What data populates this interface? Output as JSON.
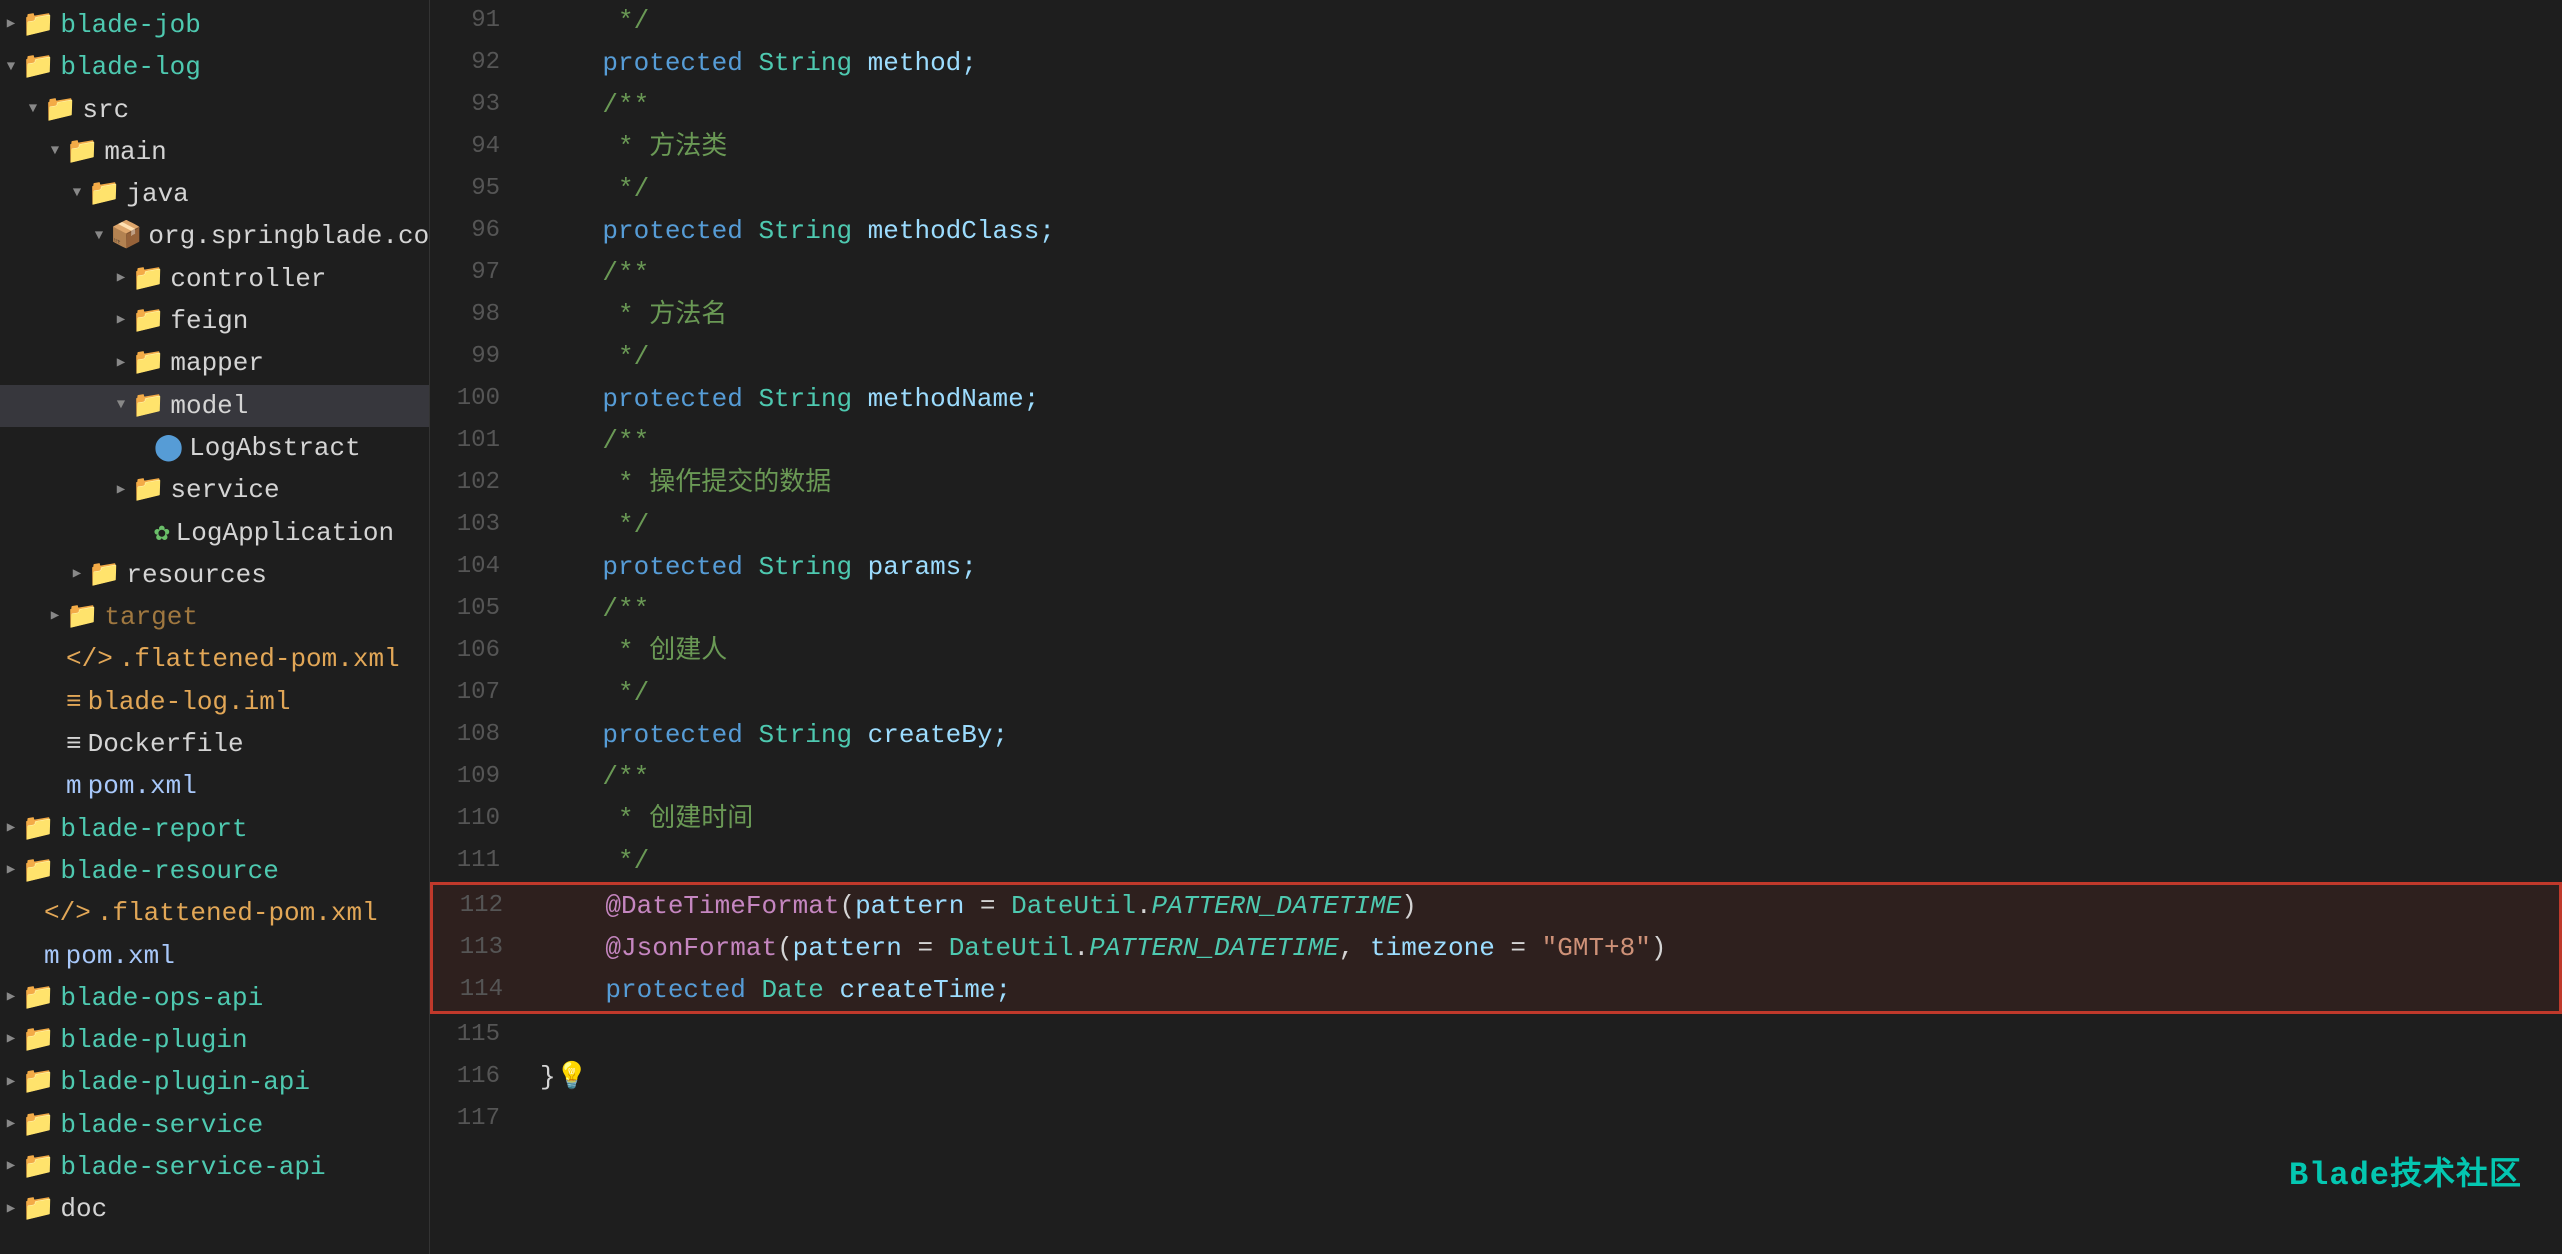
{
  "sidebar": {
    "items": [
      {
        "id": "blade-job",
        "label": "blade-job",
        "indent": 0,
        "arrow": "▶",
        "icon": "folder",
        "iconColor": "#dcb67a",
        "labelColor": "#4ec9b0",
        "selected": false
      },
      {
        "id": "blade-log",
        "label": "blade-log",
        "indent": 0,
        "arrow": "▼",
        "icon": "folder",
        "iconColor": "#dcb67a",
        "labelColor": "#4ec9b0",
        "selected": false
      },
      {
        "id": "src",
        "label": "src",
        "indent": 1,
        "arrow": "▼",
        "icon": "folder",
        "iconColor": "#dcb67a",
        "labelColor": "#d4d4d4",
        "selected": false
      },
      {
        "id": "main",
        "label": "main",
        "indent": 2,
        "arrow": "▼",
        "icon": "folder",
        "iconColor": "#dcb67a",
        "labelColor": "#d4d4d4",
        "selected": false
      },
      {
        "id": "java",
        "label": "java",
        "indent": 3,
        "arrow": "▼",
        "icon": "folder",
        "iconColor": "#569cd6",
        "labelColor": "#d4d4d4",
        "selected": false
      },
      {
        "id": "org.springblade.core.log",
        "label": "org.springblade.core.log",
        "indent": 4,
        "arrow": "▼",
        "icon": "pkg",
        "iconColor": "#dcb67a",
        "labelColor": "#d4d4d4",
        "selected": false
      },
      {
        "id": "controller",
        "label": "controller",
        "indent": 5,
        "arrow": "▶",
        "icon": "folder",
        "iconColor": "#dcb67a",
        "labelColor": "#d4d4d4",
        "selected": false
      },
      {
        "id": "feign",
        "label": "feign",
        "indent": 5,
        "arrow": "▶",
        "icon": "folder",
        "iconColor": "#dcb67a",
        "labelColor": "#d4d4d4",
        "selected": false
      },
      {
        "id": "mapper",
        "label": "mapper",
        "indent": 5,
        "arrow": "▶",
        "icon": "folder",
        "iconColor": "#dcb67a",
        "labelColor": "#d4d4d4",
        "selected": false
      },
      {
        "id": "model",
        "label": "model",
        "indent": 5,
        "arrow": "▼",
        "icon": "folder",
        "iconColor": "#dcb67a",
        "labelColor": "#d4d4d4",
        "selected": true
      },
      {
        "id": "LogAbstract",
        "label": "LogAbstract",
        "indent": 6,
        "arrow": "",
        "icon": "class",
        "iconColor": "#569cd6",
        "labelColor": "#d4d4d4",
        "selected": false
      },
      {
        "id": "service",
        "label": "service",
        "indent": 5,
        "arrow": "▶",
        "icon": "folder",
        "iconColor": "#dcb67a",
        "labelColor": "#d4d4d4",
        "selected": false
      },
      {
        "id": "LogApplication",
        "label": "LogApplication",
        "indent": 6,
        "arrow": "",
        "icon": "spring",
        "iconColor": "#6abf69",
        "labelColor": "#d4d4d4",
        "selected": false
      },
      {
        "id": "resources",
        "label": "resources",
        "indent": 3,
        "arrow": "▶",
        "icon": "folder",
        "iconColor": "#dcb67a",
        "labelColor": "#d4d4d4",
        "selected": false
      },
      {
        "id": "target",
        "label": "target",
        "indent": 2,
        "arrow": "▶",
        "icon": "folder",
        "iconColor": "#a07840",
        "labelColor": "#a07840",
        "selected": false
      },
      {
        "id": ".flattened-pom.xml",
        "label": ".flattened-pom.xml",
        "indent": 2,
        "arrow": "",
        "icon": "xml",
        "iconColor": "#e2a757",
        "labelColor": "#e2a757",
        "selected": false
      },
      {
        "id": "blade-log.iml",
        "label": "blade-log.iml",
        "indent": 2,
        "arrow": "",
        "icon": "iml",
        "iconColor": "#e2a757",
        "labelColor": "#e2a757",
        "selected": false
      },
      {
        "id": "Dockerfile",
        "label": "Dockerfile",
        "indent": 2,
        "arrow": "",
        "icon": "docker",
        "iconColor": "#d4d4d4",
        "labelColor": "#d4d4d4",
        "selected": false
      },
      {
        "id": "pom.xml",
        "label": "pom.xml",
        "indent": 2,
        "arrow": "",
        "icon": "pom",
        "iconColor": "#a8c8fa",
        "labelColor": "#a8c8fa",
        "selected": false
      },
      {
        "id": "blade-report",
        "label": "blade-report",
        "indent": 0,
        "arrow": "▶",
        "icon": "folder",
        "iconColor": "#dcb67a",
        "labelColor": "#4ec9b0",
        "selected": false
      },
      {
        "id": "blade-resource",
        "label": "blade-resource",
        "indent": 0,
        "arrow": "▶",
        "icon": "folder",
        "iconColor": "#dcb67a",
        "labelColor": "#4ec9b0",
        "selected": false
      },
      {
        "id": ".flattened-pom2.xml",
        "label": ".flattened-pom.xml",
        "indent": 1,
        "arrow": "",
        "icon": "xml",
        "iconColor": "#e2a757",
        "labelColor": "#e2a757",
        "selected": false
      },
      {
        "id": "pom2.xml",
        "label": "pom.xml",
        "indent": 1,
        "arrow": "",
        "icon": "pom",
        "iconColor": "#a8c8fa",
        "labelColor": "#a8c8fa",
        "selected": false
      },
      {
        "id": "blade-ops-api",
        "label": "blade-ops-api",
        "indent": 0,
        "arrow": "▶",
        "icon": "folder",
        "iconColor": "#dcb67a",
        "labelColor": "#4ec9b0",
        "selected": false
      },
      {
        "id": "blade-plugin",
        "label": "blade-plugin",
        "indent": 0,
        "arrow": "▶",
        "icon": "folder",
        "iconColor": "#dcb67a",
        "labelColor": "#4ec9b0",
        "selected": false
      },
      {
        "id": "blade-plugin-api",
        "label": "blade-plugin-api",
        "indent": 0,
        "arrow": "▶",
        "icon": "folder",
        "iconColor": "#dcb67a",
        "labelColor": "#4ec9b0",
        "selected": false
      },
      {
        "id": "blade-service",
        "label": "blade-service",
        "indent": 0,
        "arrow": "▶",
        "icon": "folder",
        "iconColor": "#dcb67a",
        "labelColor": "#4ec9b0",
        "selected": false
      },
      {
        "id": "blade-service-api",
        "label": "blade-service-api",
        "indent": 0,
        "arrow": "▶",
        "icon": "folder",
        "iconColor": "#dcb67a",
        "labelColor": "#4ec9b0",
        "selected": false
      },
      {
        "id": "doc",
        "label": "doc",
        "indent": 0,
        "arrow": "▶",
        "icon": "folder",
        "iconColor": "#dcb67a",
        "labelColor": "#d4d4d4",
        "selected": false
      }
    ]
  },
  "code": {
    "lines": [
      {
        "num": 91,
        "tokens": [
          {
            "text": "    ",
            "cls": "plain"
          },
          {
            "text": " */",
            "cls": "comment"
          }
        ],
        "highlight": false
      },
      {
        "num": 92,
        "tokens": [
          {
            "text": "    ",
            "cls": "plain"
          },
          {
            "text": "protected ",
            "cls": "kw"
          },
          {
            "text": "String ",
            "cls": "type"
          },
          {
            "text": "method;",
            "cls": "field"
          }
        ],
        "highlight": false
      },
      {
        "num": 93,
        "tokens": [
          {
            "text": "    ",
            "cls": "plain"
          },
          {
            "text": "/**",
            "cls": "comment"
          }
        ],
        "highlight": false
      },
      {
        "num": 94,
        "tokens": [
          {
            "text": "    ",
            "cls": "plain"
          },
          {
            "text": " * 方法类",
            "cls": "comment"
          }
        ],
        "highlight": false
      },
      {
        "num": 95,
        "tokens": [
          {
            "text": "    ",
            "cls": "plain"
          },
          {
            "text": " */",
            "cls": "comment"
          }
        ],
        "highlight": false
      },
      {
        "num": 96,
        "tokens": [
          {
            "text": "    ",
            "cls": "plain"
          },
          {
            "text": "protected ",
            "cls": "kw"
          },
          {
            "text": "String ",
            "cls": "type"
          },
          {
            "text": "methodClass;",
            "cls": "field"
          }
        ],
        "highlight": false
      },
      {
        "num": 97,
        "tokens": [
          {
            "text": "    ",
            "cls": "plain"
          },
          {
            "text": "/**",
            "cls": "comment"
          }
        ],
        "highlight": false
      },
      {
        "num": 98,
        "tokens": [
          {
            "text": "    ",
            "cls": "plain"
          },
          {
            "text": " * 方法名",
            "cls": "comment"
          }
        ],
        "highlight": false
      },
      {
        "num": 99,
        "tokens": [
          {
            "text": "    ",
            "cls": "plain"
          },
          {
            "text": " */",
            "cls": "comment"
          }
        ],
        "highlight": false
      },
      {
        "num": 100,
        "tokens": [
          {
            "text": "    ",
            "cls": "plain"
          },
          {
            "text": "protected ",
            "cls": "kw"
          },
          {
            "text": "String ",
            "cls": "type"
          },
          {
            "text": "methodName;",
            "cls": "field"
          }
        ],
        "highlight": false
      },
      {
        "num": 101,
        "tokens": [
          {
            "text": "    ",
            "cls": "plain"
          },
          {
            "text": "/**",
            "cls": "comment"
          }
        ],
        "highlight": false
      },
      {
        "num": 102,
        "tokens": [
          {
            "text": "    ",
            "cls": "plain"
          },
          {
            "text": " * 操作提交的数据",
            "cls": "comment"
          }
        ],
        "highlight": false
      },
      {
        "num": 103,
        "tokens": [
          {
            "text": "    ",
            "cls": "plain"
          },
          {
            "text": " */",
            "cls": "comment"
          }
        ],
        "highlight": false
      },
      {
        "num": 104,
        "tokens": [
          {
            "text": "    ",
            "cls": "plain"
          },
          {
            "text": "protected ",
            "cls": "kw"
          },
          {
            "text": "String ",
            "cls": "type"
          },
          {
            "text": "params;",
            "cls": "field"
          }
        ],
        "highlight": false
      },
      {
        "num": 105,
        "tokens": [
          {
            "text": "    ",
            "cls": "plain"
          },
          {
            "text": "/**",
            "cls": "comment"
          }
        ],
        "highlight": false
      },
      {
        "num": 106,
        "tokens": [
          {
            "text": "    ",
            "cls": "plain"
          },
          {
            "text": " * 创建人",
            "cls": "comment"
          }
        ],
        "highlight": false
      },
      {
        "num": 107,
        "tokens": [
          {
            "text": "    ",
            "cls": "plain"
          },
          {
            "text": " */",
            "cls": "comment"
          }
        ],
        "highlight": false
      },
      {
        "num": 108,
        "tokens": [
          {
            "text": "    ",
            "cls": "plain"
          },
          {
            "text": "protected ",
            "cls": "kw"
          },
          {
            "text": "String ",
            "cls": "type"
          },
          {
            "text": "createBy;",
            "cls": "field"
          }
        ],
        "highlight": false
      },
      {
        "num": 109,
        "tokens": [
          {
            "text": "    ",
            "cls": "plain"
          },
          {
            "text": "/**",
            "cls": "comment"
          }
        ],
        "highlight": false
      },
      {
        "num": 110,
        "tokens": [
          {
            "text": "    ",
            "cls": "plain"
          },
          {
            "text": " * 创建时间",
            "cls": "comment"
          }
        ],
        "highlight": false
      },
      {
        "num": 111,
        "tokens": [
          {
            "text": "    ",
            "cls": "plain"
          },
          {
            "text": " */",
            "cls": "comment"
          }
        ],
        "highlight": false
      },
      {
        "num": 112,
        "tokens": [
          {
            "text": "    ",
            "cls": "plain"
          },
          {
            "text": "@DateTimeFormat",
            "cls": "annotation"
          },
          {
            "text": "(",
            "cls": "punct"
          },
          {
            "text": "pattern",
            "cls": "field"
          },
          {
            "text": " = ",
            "cls": "eq"
          },
          {
            "text": "DateUtil",
            "cls": "type"
          },
          {
            "text": ".",
            "cls": "punct"
          },
          {
            "text": "PATTERN_DATETIME",
            "cls": "italic-plain"
          },
          {
            "text": ")",
            "cls": "punct"
          }
        ],
        "highlight": true
      },
      {
        "num": 113,
        "tokens": [
          {
            "text": "    ",
            "cls": "plain"
          },
          {
            "text": "@JsonFormat",
            "cls": "annotation"
          },
          {
            "text": "(",
            "cls": "punct"
          },
          {
            "text": "pattern",
            "cls": "field"
          },
          {
            "text": " = ",
            "cls": "eq"
          },
          {
            "text": "DateUtil",
            "cls": "type"
          },
          {
            "text": ".",
            "cls": "punct"
          },
          {
            "text": "PATTERN_DATETIME",
            "cls": "italic-plain"
          },
          {
            "text": ", ",
            "cls": "punct"
          },
          {
            "text": "timezone",
            "cls": "field"
          },
          {
            "text": " = ",
            "cls": "eq"
          },
          {
            "text": "\"GMT+8\"",
            "cls": "str"
          },
          {
            "text": ")",
            "cls": "punct"
          }
        ],
        "highlight": true
      },
      {
        "num": 114,
        "tokens": [
          {
            "text": "    ",
            "cls": "plain"
          },
          {
            "text": "protected ",
            "cls": "kw"
          },
          {
            "text": "Date ",
            "cls": "type"
          },
          {
            "text": "createTime;",
            "cls": "field"
          }
        ],
        "highlight": true
      },
      {
        "num": 115,
        "tokens": [
          {
            "text": "",
            "cls": "plain"
          }
        ],
        "highlight": false
      },
      {
        "num": 116,
        "tokens": [
          {
            "text": "}",
            "cls": "plain"
          },
          {
            "text": "💡",
            "cls": "plain"
          }
        ],
        "highlight": false
      },
      {
        "num": 117,
        "tokens": [
          {
            "text": "",
            "cls": "plain"
          }
        ],
        "highlight": false
      }
    ]
  },
  "watermark": {
    "text": "Blade技术社区"
  }
}
